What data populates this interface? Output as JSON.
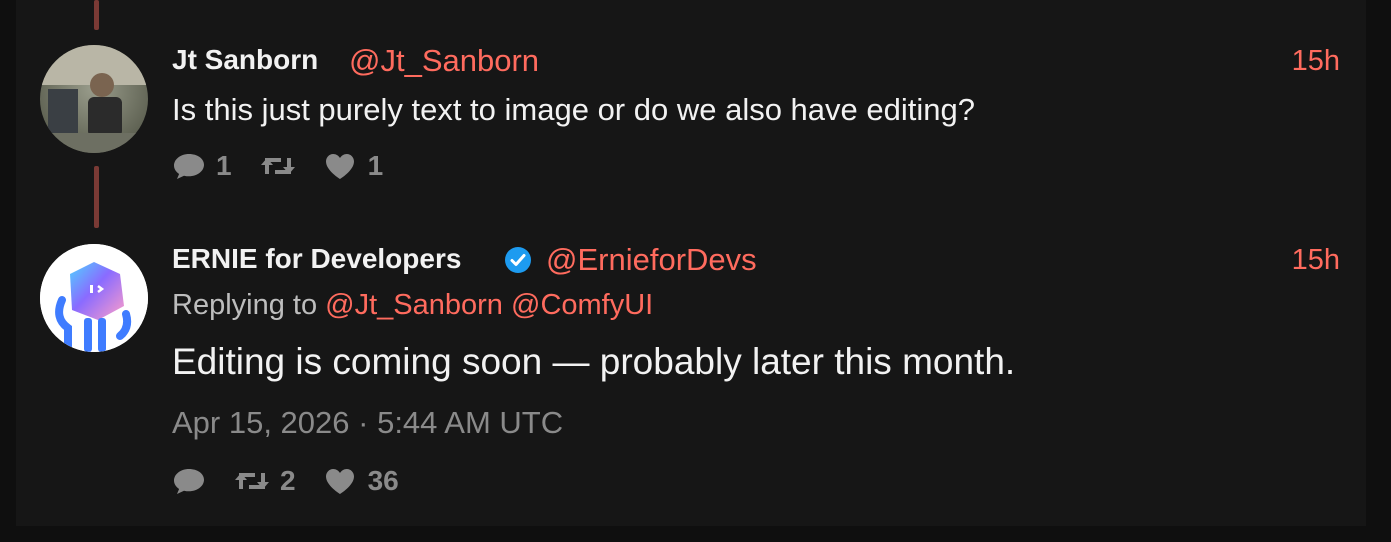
{
  "tweets": [
    {
      "name": "Jt Sanborn",
      "handle": "@Jt_Sanborn",
      "time": "15h",
      "text": "Is this just purely text to image or do we also have editing?",
      "stats": {
        "replies": "1",
        "retweets": "",
        "likes": "1"
      },
      "avatar_icon": "person-photo-avatar"
    },
    {
      "name": "ERNIE for Developers",
      "verified": true,
      "handle": "@ErnieforDevs",
      "time": "15h",
      "replying_prefix": "Replying to",
      "replying_to": [
        "@Jt_Sanborn",
        "@ComfyUI"
      ],
      "text": "Editing is coming soon — probably later this month.",
      "date": "Apr 15, 2026 · 5:44 AM UTC",
      "stats": {
        "replies": "",
        "retweets": "2",
        "likes": "36"
      },
      "avatar_icon": "robot-mascot-avatar"
    }
  ],
  "colors": {
    "accent": "#ff6b5e",
    "background": "#161616",
    "thread_line": "#7a3a35",
    "verified": "#1d9bf0"
  }
}
